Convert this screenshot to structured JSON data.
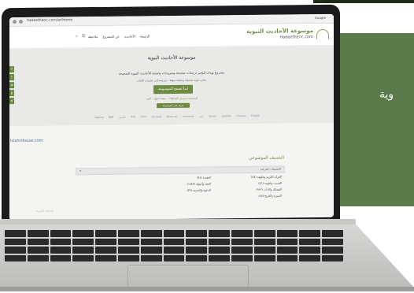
{
  "browser": {
    "url": "hadeethenc.com/ar/home",
    "right_label": "Google"
  },
  "site": {
    "logo_title": "موسوعة الأحاديث النبوية",
    "logo_domain": "HadeethEnc.com",
    "nav": [
      "الرئيسة",
      "الأحاديث",
      "عن المشروع",
      "ملاحظة"
    ],
    "hero_title": "موسوعة الأحاديث النبوية",
    "hero_subtitle": "مشروع يهدف لتوفير ترجمات صحيحة وشروحات واضحة للأحاديث النبوية الصحيحة",
    "hero_subtitle2": "معاني نبوية صحيحة وجامعة سهلة - مترجمة إلى عشرات اللغات",
    "start_button": "ابدأ تصفح الموسوعة",
    "hero_note": "للمساعدة وعرض التوجيهات - صفحة قبول - الجدد",
    "small_button": "تعرف على الموسوعة",
    "languages": [
      "English",
      "Français",
      "Español",
      "Türkçe",
      "اردو",
      "Indonesia",
      "Bosanski",
      "Русский",
      "বাংলা",
      "中文",
      "فارسی",
      "हिन्दी",
      "Tagalog"
    ],
    "social_icons": [
      "f",
      "t",
      "w",
      "p",
      "e"
    ],
    "side_logo": "IslamHouse.com",
    "section_title": "التصنيف الموضوعي",
    "search_placeholder": "التصنيفات الفرعية",
    "categories": [
      "القرآن الكريم وعلومه (٥٨)",
      "العقيدة (٩٨)",
      "الحديث وعلومه (٨٦)",
      "الفقه وأصوله (١٥٨٣)",
      "الفضائل والآداب (٩٢٢)",
      "الدعوة والحسبة (٣٩)",
      "السيرة والتاريخ (٤٥)",
      ""
    ],
    "footer_ghost": "الجمعية الخيرية"
  },
  "banner": {
    "side_text": "وية"
  },
  "colors": {
    "brand_green": "#6e8b42",
    "panel_green": "#5a7a4a",
    "laptop_frame": "#1b1b1d"
  }
}
